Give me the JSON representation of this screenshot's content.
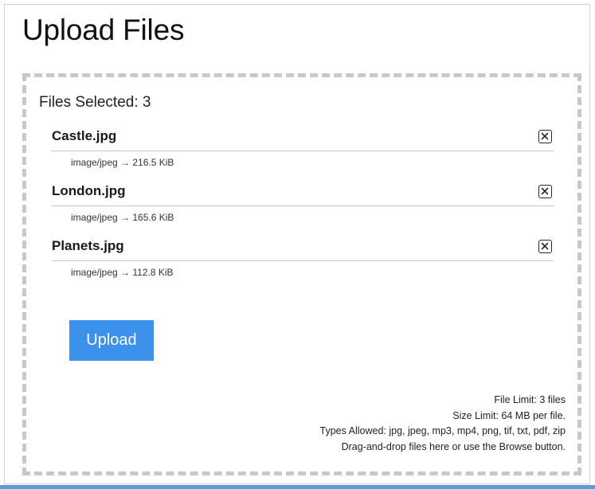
{
  "page": {
    "title": "Upload Files"
  },
  "dropzone": {
    "files_selected_label": "Files Selected: 3",
    "files": [
      {
        "name": "Castle.jpg",
        "meta": "image/jpeg → 216.5 KiB",
        "remove_icon": "close-box-icon"
      },
      {
        "name": "London.jpg",
        "meta": "image/jpeg → 165.6 KiB",
        "remove_icon": "close-box-icon"
      },
      {
        "name": "Planets.jpg",
        "meta": "image/jpeg → 112.8 KiB",
        "remove_icon": "close-box-icon"
      }
    ],
    "upload_button_label": "Upload",
    "limits": {
      "file_limit": "File Limit: 3 files",
      "size_limit": "Size Limit: 64 MB per file.",
      "types_allowed": "Types Allowed: jpg, jpeg, mp3, mp4, png, tif, txt, pdf, zip",
      "instructions": "Drag-and-drop files here or use the Browse button."
    }
  },
  "colors": {
    "accent": "#3b91ec",
    "dropzone_border": "#c8c8c8",
    "bottom_strip": "#5a9de0"
  }
}
